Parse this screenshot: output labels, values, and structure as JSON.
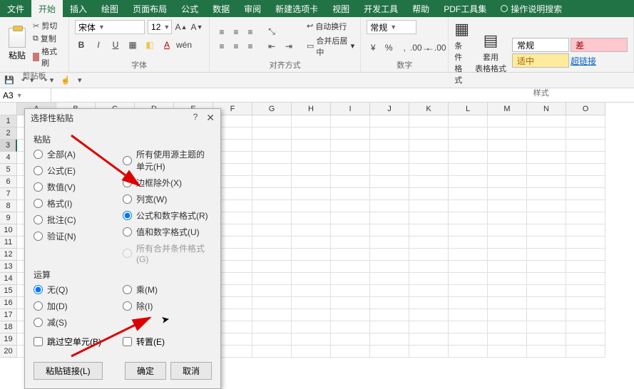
{
  "tabs": {
    "file": "文件",
    "home": "开始",
    "insert": "插入",
    "draw": "绘图",
    "pagelayout": "页面布局",
    "formulas": "公式",
    "data": "数据",
    "review": "审阅",
    "newtab": "新建选项卡",
    "view": "视图",
    "developer": "开发工具",
    "help": "帮助",
    "pdf": "PDF工具集",
    "tell": "操作说明搜索"
  },
  "ribbon": {
    "clipboard": {
      "label": "剪贴板",
      "paste": "粘贴",
      "cut": "剪切",
      "copy": "复制",
      "format_painter": "格式刷"
    },
    "font": {
      "label": "字体",
      "name": "宋体",
      "size": "12"
    },
    "align": {
      "label": "对齐方式",
      "wrap": "自动换行",
      "merge": "合并后居中"
    },
    "number": {
      "label": "数字",
      "format": "常规"
    },
    "styles": {
      "label": "样式",
      "cond": "条件格式",
      "table": "套用\n表格格式",
      "normal": "常规",
      "bad": "差",
      "ok": "适中",
      "link": "超链接"
    }
  },
  "namebox": "A3",
  "columns": [
    "A",
    "B",
    "C",
    "D",
    "E",
    "F",
    "G",
    "H",
    "I",
    "J",
    "K",
    "L",
    "M",
    "N",
    "O"
  ],
  "rows": [
    "1",
    "2",
    "3",
    "4",
    "5",
    "6",
    "7",
    "8",
    "9",
    "10",
    "11",
    "12",
    "13",
    "14",
    "15",
    "16",
    "17",
    "18",
    "19",
    "20"
  ],
  "dialog": {
    "title": "选择性粘贴",
    "help": "?",
    "section_paste": "粘贴",
    "section_op": "运算",
    "paste_opts_left": [
      {
        "key": "all",
        "label": "全部(A)"
      },
      {
        "key": "formulas",
        "label": "公式(E)"
      },
      {
        "key": "values",
        "label": "数值(V)"
      },
      {
        "key": "formats",
        "label": "格式(I)"
      },
      {
        "key": "comments",
        "label": "批注(C)"
      },
      {
        "key": "validation",
        "label": "验证(N)"
      }
    ],
    "paste_opts_right": [
      {
        "key": "theme",
        "label": "所有使用源主题的单元(H)"
      },
      {
        "key": "noborder",
        "label": "边框除外(X)"
      },
      {
        "key": "colwidth",
        "label": "列宽(W)"
      },
      {
        "key": "formnum",
        "label": "公式和数字格式(R)"
      },
      {
        "key": "valnum",
        "label": "值和数字格式(U)"
      },
      {
        "key": "condfmt",
        "label": "所有合并条件格式(G)"
      }
    ],
    "paste_selected": "formnum",
    "op_opts_left": [
      {
        "key": "none",
        "label": "无(Q)"
      },
      {
        "key": "add",
        "label": "加(D)"
      },
      {
        "key": "sub",
        "label": "减(S)"
      }
    ],
    "op_opts_right": [
      {
        "key": "mul",
        "label": "乘(M)"
      },
      {
        "key": "div",
        "label": "除(I)"
      }
    ],
    "op_selected": "none",
    "skip_blanks": "跳过空单元(B)",
    "transpose": "转置(E)",
    "paste_link": "粘贴链接(L)",
    "ok": "确定",
    "cancel": "取消"
  }
}
